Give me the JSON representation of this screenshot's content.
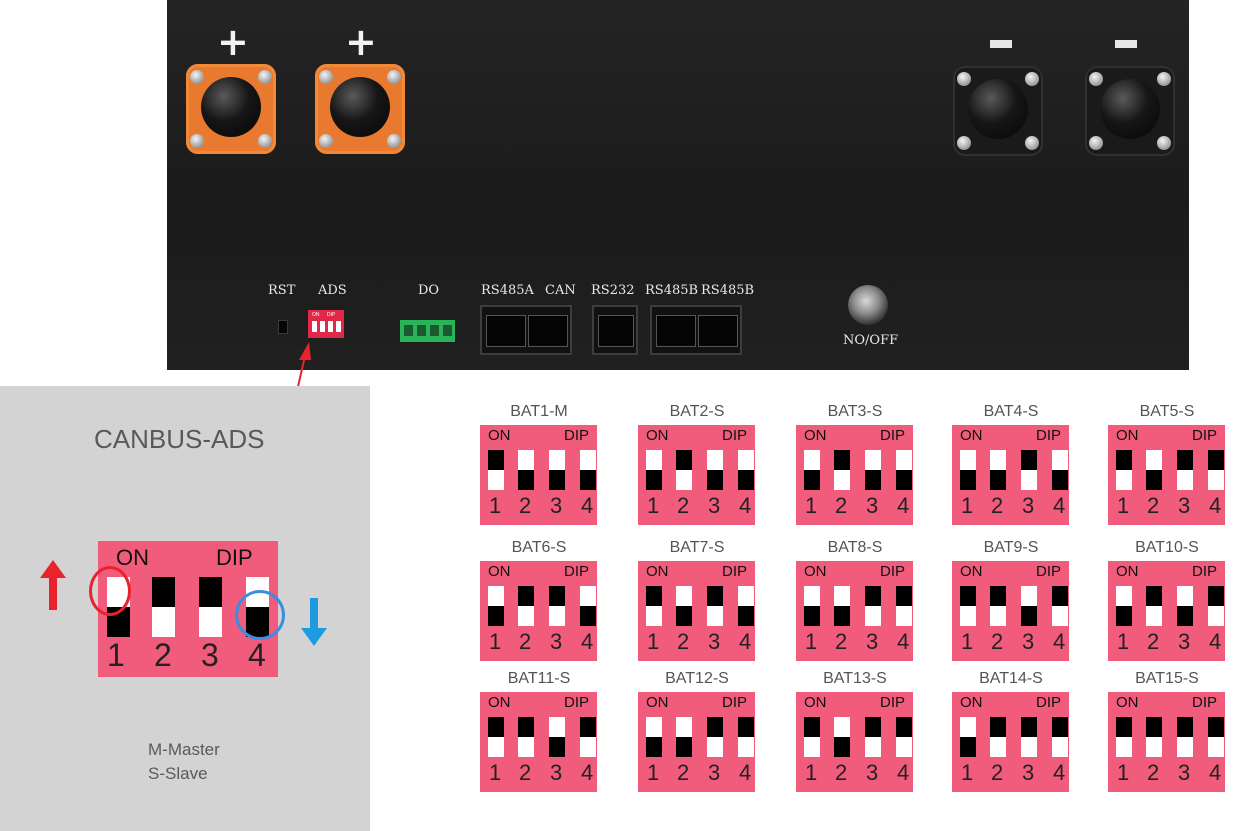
{
  "panel": {
    "plus_sign": "+",
    "labels": {
      "rst": "RST",
      "ads": "ADS",
      "do": "DO",
      "rs485a": "RS485A",
      "can": "CAN",
      "rs232": "RS232",
      "rs485b_1": "RS485B",
      "rs485b_2": "RS485B",
      "power": "NO/OFF"
    },
    "ads_switch": {
      "on": "ON",
      "dip": "DIP",
      "numbers": "1 2 3 4"
    }
  },
  "card": {
    "title": "CANBUS-ADS",
    "switch": {
      "on_label": "ON",
      "dip_label": "DIP",
      "numbers": [
        "1",
        "2",
        "3",
        "4"
      ],
      "positions": [
        "up",
        "down",
        "down",
        "up"
      ]
    },
    "legend": [
      "M-Master",
      "S-Slave"
    ]
  },
  "colors": {
    "switch_body": "#f25c7c",
    "up_arrow": "#e8232c",
    "down_arrow": "#1e9be0",
    "orange_terminal": "#e8792e"
  },
  "icons": {
    "up_arrow": "arrow-up-icon",
    "down_arrow": "arrow-down-icon"
  },
  "bat_grid": [
    {
      "name": "BAT1-M",
      "on": "ON",
      "dip": "DIP",
      "switches": [
        "up",
        "down",
        "down",
        "down"
      ]
    },
    {
      "name": "BAT2-S",
      "on": "ON",
      "dip": "DIP",
      "switches": [
        "down",
        "up",
        "down",
        "down"
      ]
    },
    {
      "name": "BAT3-S",
      "on": "ON",
      "dip": "DIP",
      "switches": [
        "down",
        "up",
        "down",
        "down"
      ]
    },
    {
      "name": "BAT4-S",
      "on": "ON",
      "dip": "DIP",
      "switches": [
        "down",
        "down",
        "up",
        "down"
      ]
    },
    {
      "name": "BAT5-S",
      "on": "ON",
      "dip": "DIP",
      "switches": [
        "up",
        "down",
        "up",
        "up"
      ]
    },
    {
      "name": "BAT6-S",
      "on": "ON",
      "dip": "DIP",
      "switches": [
        "down",
        "up",
        "up",
        "down"
      ]
    },
    {
      "name": "BAT7-S",
      "on": "ON",
      "dip": "DIP",
      "switches": [
        "up",
        "down",
        "up",
        "down"
      ]
    },
    {
      "name": "BAT8-S",
      "on": "ON",
      "dip": "DIP",
      "switches": [
        "down",
        "down",
        "up",
        "up"
      ]
    },
    {
      "name": "BAT9-S",
      "on": "ON",
      "dip": "DIP",
      "switches": [
        "up",
        "up",
        "down",
        "up"
      ]
    },
    {
      "name": "BAT10-S",
      "on": "ON",
      "dip": "DIP",
      "switches": [
        "down",
        "up",
        "down",
        "up"
      ]
    },
    {
      "name": "BAT11-S",
      "on": "ON",
      "dip": "DIP",
      "switches": [
        "up",
        "up",
        "down",
        "up"
      ]
    },
    {
      "name": "BAT12-S",
      "on": "ON",
      "dip": "DIP",
      "switches": [
        "down",
        "down",
        "up",
        "up"
      ]
    },
    {
      "name": "BAT13-S",
      "on": "ON",
      "dip": "DIP",
      "switches": [
        "up",
        "down",
        "up",
        "up"
      ]
    },
    {
      "name": "BAT14-S",
      "on": "ON",
      "dip": "DIP",
      "switches": [
        "down",
        "up",
        "up",
        "up"
      ]
    },
    {
      "name": "BAT15-S",
      "on": "ON",
      "dip": "DIP",
      "switches": [
        "up",
        "up",
        "up",
        "up"
      ]
    }
  ]
}
